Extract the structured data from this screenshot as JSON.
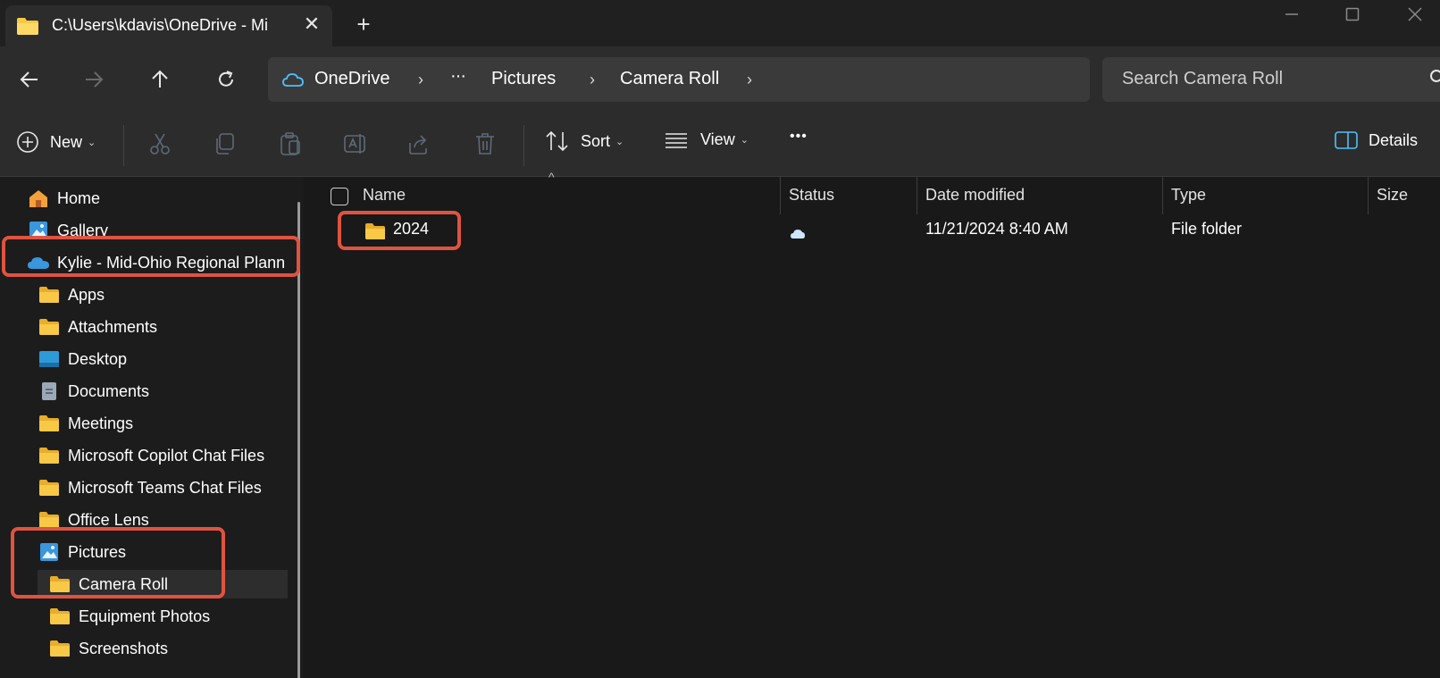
{
  "window": {
    "tab_title": "C:\\Users\\kdavis\\OneDrive - Mi",
    "close_symbol": "✕",
    "new_tab_symbol": "+"
  },
  "address": {
    "root": "OneDrive",
    "ellipsis": "···",
    "crumbs": [
      "Pictures",
      "Camera Roll"
    ],
    "separator": "›",
    "search_placeholder": "Search Camera Roll"
  },
  "commands": {
    "new_label": "New",
    "sort_label": "Sort",
    "view_label": "View",
    "more_label": "•••",
    "details_label": "Details",
    "chevron": "⌄"
  },
  "nav": {
    "items": [
      {
        "label": "Home",
        "icon": "home-icon"
      },
      {
        "label": "Gallery",
        "icon": "gallery-icon"
      },
      {
        "label": "Kylie - Mid-Ohio Regional Plann",
        "icon": "onedrive-cloud-icon"
      },
      {
        "label": "Apps",
        "icon": "folder-icon"
      },
      {
        "label": "Attachments",
        "icon": "folder-icon"
      },
      {
        "label": "Desktop",
        "icon": "desktop-icon"
      },
      {
        "label": "Documents",
        "icon": "documents-icon"
      },
      {
        "label": "Meetings",
        "icon": "folder-icon"
      },
      {
        "label": "Microsoft Copilot Chat Files",
        "icon": "folder-icon"
      },
      {
        "label": "Microsoft Teams Chat Files",
        "icon": "folder-icon"
      },
      {
        "label": "Office Lens",
        "icon": "folder-icon"
      },
      {
        "label": "Pictures",
        "icon": "pictures-icon"
      },
      {
        "label": "Camera Roll",
        "icon": "folder-icon"
      },
      {
        "label": "Equipment Photos",
        "icon": "folder-icon"
      },
      {
        "label": "Screenshots",
        "icon": "folder-icon"
      }
    ],
    "selected": "Camera Roll"
  },
  "files": {
    "columns": {
      "name": "Name",
      "status": "Status",
      "date": "Date modified",
      "type": "Type",
      "size": "Size"
    },
    "rows": [
      {
        "name": "2024",
        "status_icon": "cloud-icon",
        "date": "11/21/2024 8:40 AM",
        "type": "File folder",
        "size": ""
      }
    ]
  },
  "colors": {
    "highlight": "#e0533f",
    "folder": "#f8c847",
    "onedrive": "#3a96dd"
  }
}
